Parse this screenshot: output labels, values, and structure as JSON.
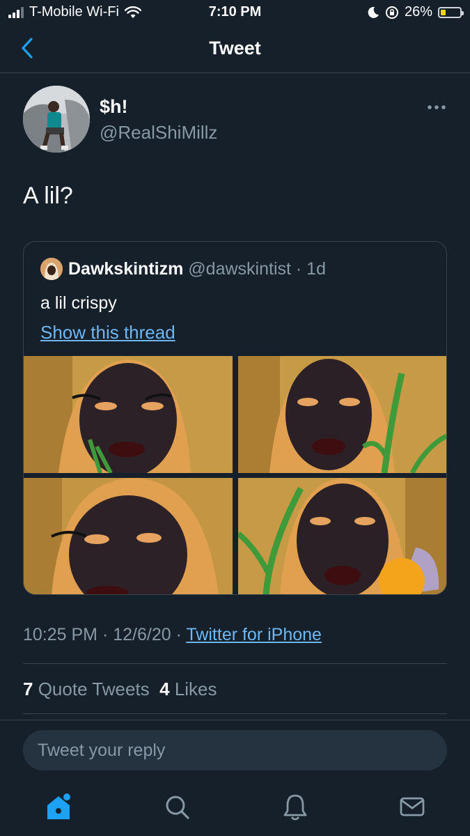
{
  "status_bar": {
    "carrier": "T-Mobile Wi-Fi",
    "time": "7:10 PM",
    "battery": "26%",
    "battery_level": 0.26,
    "icons": [
      "signal-icon",
      "wifi-icon",
      "moon-icon",
      "orientation-lock-icon",
      "battery-icon"
    ]
  },
  "nav": {
    "title": "Tweet",
    "back_icon": "chevron-left-icon"
  },
  "tweet": {
    "author_name": "$h!",
    "author_handle": "@RealShiMillz",
    "text": "A lil?",
    "timestamp_time": "10:25 PM",
    "timestamp_date": "12/6/20",
    "source": "Twitter for iPhone",
    "quote_tweets_count": "7",
    "quote_tweets_label": "Quote Tweets",
    "likes_count": "4",
    "likes_label": "Likes"
  },
  "quoted": {
    "author_name": "Dawkskintizm",
    "author_handle": "@dawskintist",
    "age": "1d",
    "text": "a lil crispy",
    "thread_link": "Show this thread",
    "photo_count": 4
  },
  "reply": {
    "placeholder": "Tweet your reply"
  },
  "tabs": [
    "home-icon",
    "search-icon",
    "notifications-icon",
    "messages-icon"
  ],
  "colors": {
    "background": "#15202b",
    "accent": "#1da1f2",
    "link": "#6fb7f2",
    "muted": "#8899a6",
    "border": "#38444d"
  }
}
